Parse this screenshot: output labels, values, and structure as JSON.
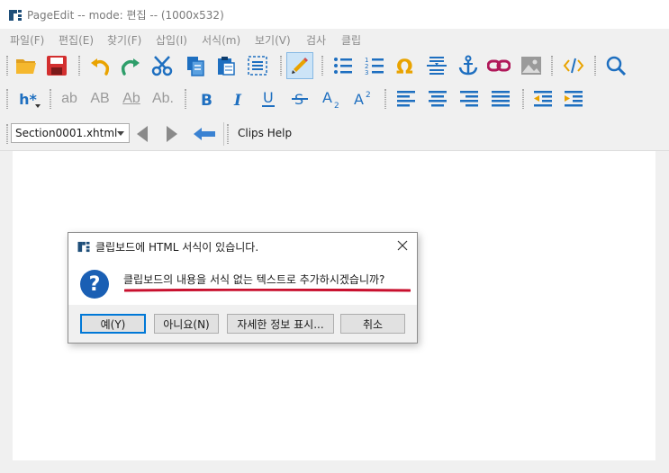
{
  "window": {
    "title": "PageEdit -- mode: 편집 -- (1000x532)"
  },
  "menu": [
    "파일(F)",
    "편집(E)",
    "찾기(F)",
    "삽입(I)",
    "서식(m)",
    "보기(V)",
    "검사",
    "클립"
  ],
  "toolbar2": {
    "heading": "h*",
    "case_buttons": [
      "ab",
      "AB",
      "Ab",
      "Ab."
    ]
  },
  "toolbar3": {
    "section_file": "Section0001.xhtml",
    "clips_label": "Clips Help"
  },
  "dialog": {
    "title": "클립보드에 HTML 서식이 있습니다.",
    "message": "클립보드의 내용을 서식 없는 텍스트로 추가하시겠습니까?",
    "buttons": {
      "yes": "예(Y)",
      "no": "아니요(N)",
      "details": "자세한 정보 표시...",
      "cancel": "취소"
    }
  },
  "icons": {
    "toolbar1": [
      "open-folder-icon",
      "save-icon",
      "undo-icon",
      "redo-icon",
      "cut-icon",
      "copy-icon",
      "paste-icon",
      "select-all-icon",
      "edit-pencil-icon",
      "bullet-list-icon",
      "numbered-list-icon",
      "omega-special-char-icon",
      "insert-break-icon",
      "anchor-icon",
      "link-icon",
      "image-icon",
      "code-view-icon",
      "search-icon"
    ],
    "toolbar2": [
      "bold-icon",
      "italic-icon",
      "underline-icon",
      "strikethrough-icon",
      "subscript-icon",
      "superscript-icon",
      "align-left-icon",
      "align-center-icon",
      "align-right-icon",
      "justify-icon",
      "outdent-icon",
      "indent-icon"
    ],
    "toolbar3": [
      "back-arrow-icon",
      "forward-arrow-icon",
      "return-arrow-icon"
    ]
  },
  "colors": {
    "accent": "#1e6fc0",
    "active_bg": "#cce4f7",
    "underline_annotation": "#c8102e"
  }
}
